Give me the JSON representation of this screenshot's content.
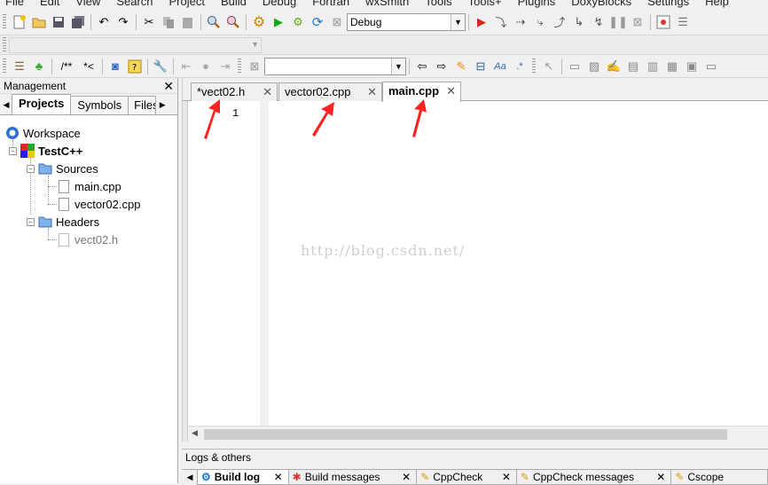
{
  "menu": [
    "File",
    "Edit",
    "View",
    "Search",
    "Project",
    "Build",
    "Debug",
    "Fortran",
    "wxSmith",
    "Tools",
    "Tools+",
    "Plugins",
    "DoxyBlocks",
    "Settings",
    "Help"
  ],
  "toolbar": {
    "build_target": "Debug",
    "doxy_comment": "/**",
    "doxy_line": "*<"
  },
  "management": {
    "title": "Management",
    "tabs": [
      "Projects",
      "Symbols",
      "Files"
    ],
    "tree": {
      "workspace": "Workspace",
      "project": "TestC++",
      "sources": "Sources",
      "source_files": [
        "main.cpp",
        "vector02.cpp"
      ],
      "headers": "Headers",
      "header_files": [
        "vect02.h"
      ]
    }
  },
  "editor": {
    "tabs": [
      "*vect02.h",
      "vector02.cpp",
      "main.cpp"
    ],
    "active_tab": "main.cpp",
    "line_number": "1",
    "watermark": "http://blog.csdn.net/"
  },
  "logs": {
    "title": "Logs & others",
    "tabs": [
      "Build log",
      "Build messages",
      "CppCheck",
      "CppCheck messages",
      "Cscope"
    ]
  },
  "colors": {
    "annotation_arrow": "#ff2222"
  }
}
